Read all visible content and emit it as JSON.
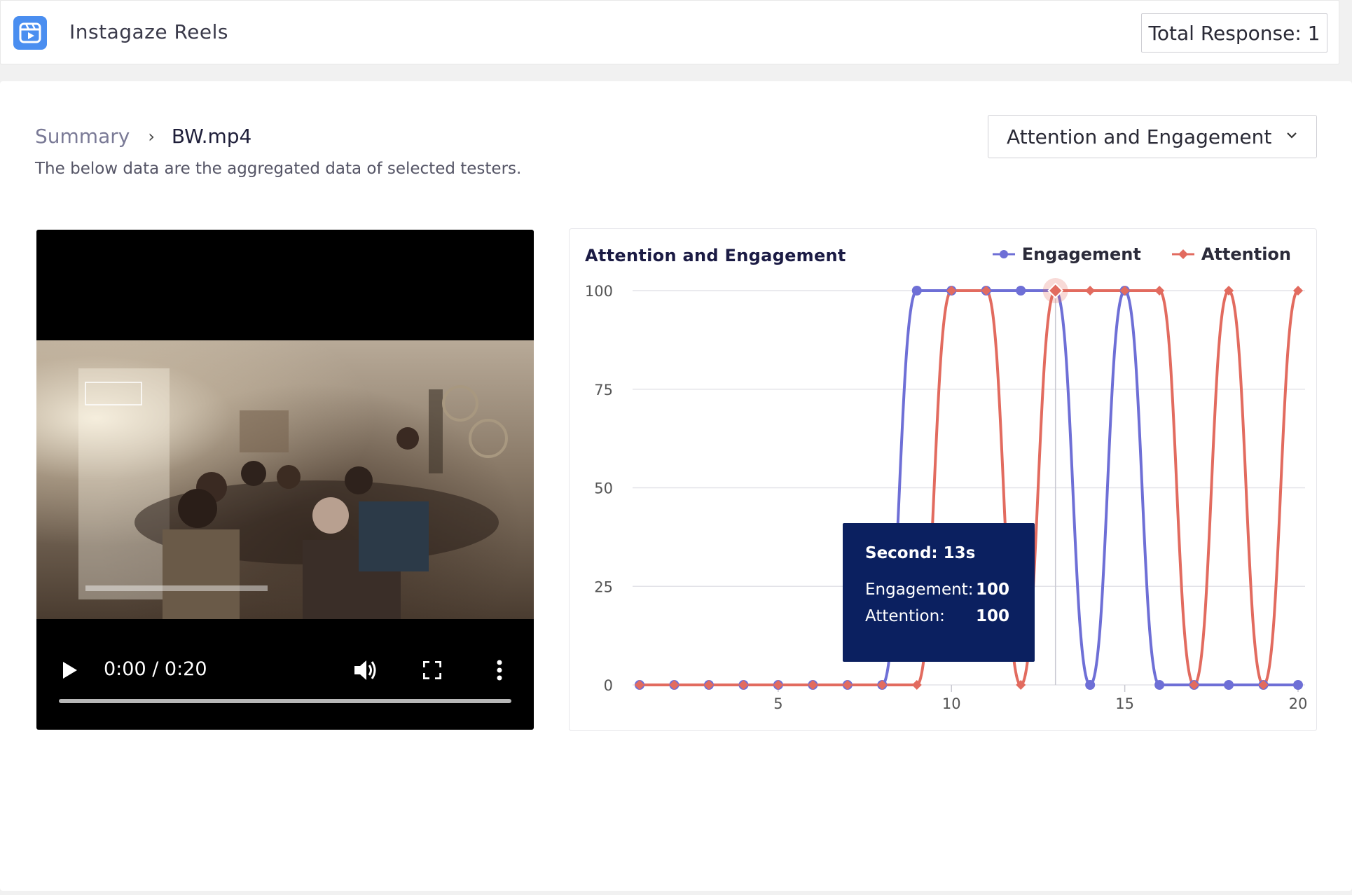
{
  "app": {
    "title": "Instagaze Reels",
    "total_response": "Total Response: 1"
  },
  "breadcrumb": {
    "parent": "Summary",
    "current": "BW.mp4"
  },
  "subtitle": "The below data are the aggregated data of selected testers.",
  "metric_select": {
    "value": "Attention and Engagement"
  },
  "video": {
    "time": "0:00 / 0:20",
    "progress": 0
  },
  "colors": {
    "engagement": "#6e6fd6",
    "attention": "#e26b5f",
    "tooltip_bg": "#0b2060",
    "accent": "#4a8ef0"
  },
  "chart_data": {
    "type": "line",
    "title": "Attention and Engagement",
    "x": [
      1,
      2,
      3,
      4,
      5,
      6,
      7,
      8,
      9,
      10,
      11,
      12,
      13,
      14,
      15,
      16,
      17,
      18,
      19,
      20
    ],
    "xticks": [
      5,
      10,
      15,
      20
    ],
    "yticks": [
      0,
      25,
      50,
      75,
      100
    ],
    "ylim": [
      0,
      100
    ],
    "xlim": [
      1,
      20
    ],
    "grid": true,
    "legend": "top-right",
    "series": [
      {
        "name": "Engagement",
        "values": [
          0,
          0,
          0,
          0,
          0,
          0,
          0,
          0,
          100,
          100,
          100,
          100,
          100,
          0,
          100,
          0,
          0,
          0,
          0,
          0
        ]
      },
      {
        "name": "Attention",
        "values": [
          0,
          0,
          0,
          0,
          0,
          0,
          0,
          0,
          0,
          100,
          100,
          0,
          100,
          100,
          100,
          100,
          0,
          100,
          0,
          100
        ]
      }
    ],
    "tooltip": {
      "title": "Second: 13s",
      "engagement_label": "Engagement:",
      "engagement_value": "100",
      "attention_label": "Attention:",
      "attention_value": "100",
      "x": 13
    }
  }
}
